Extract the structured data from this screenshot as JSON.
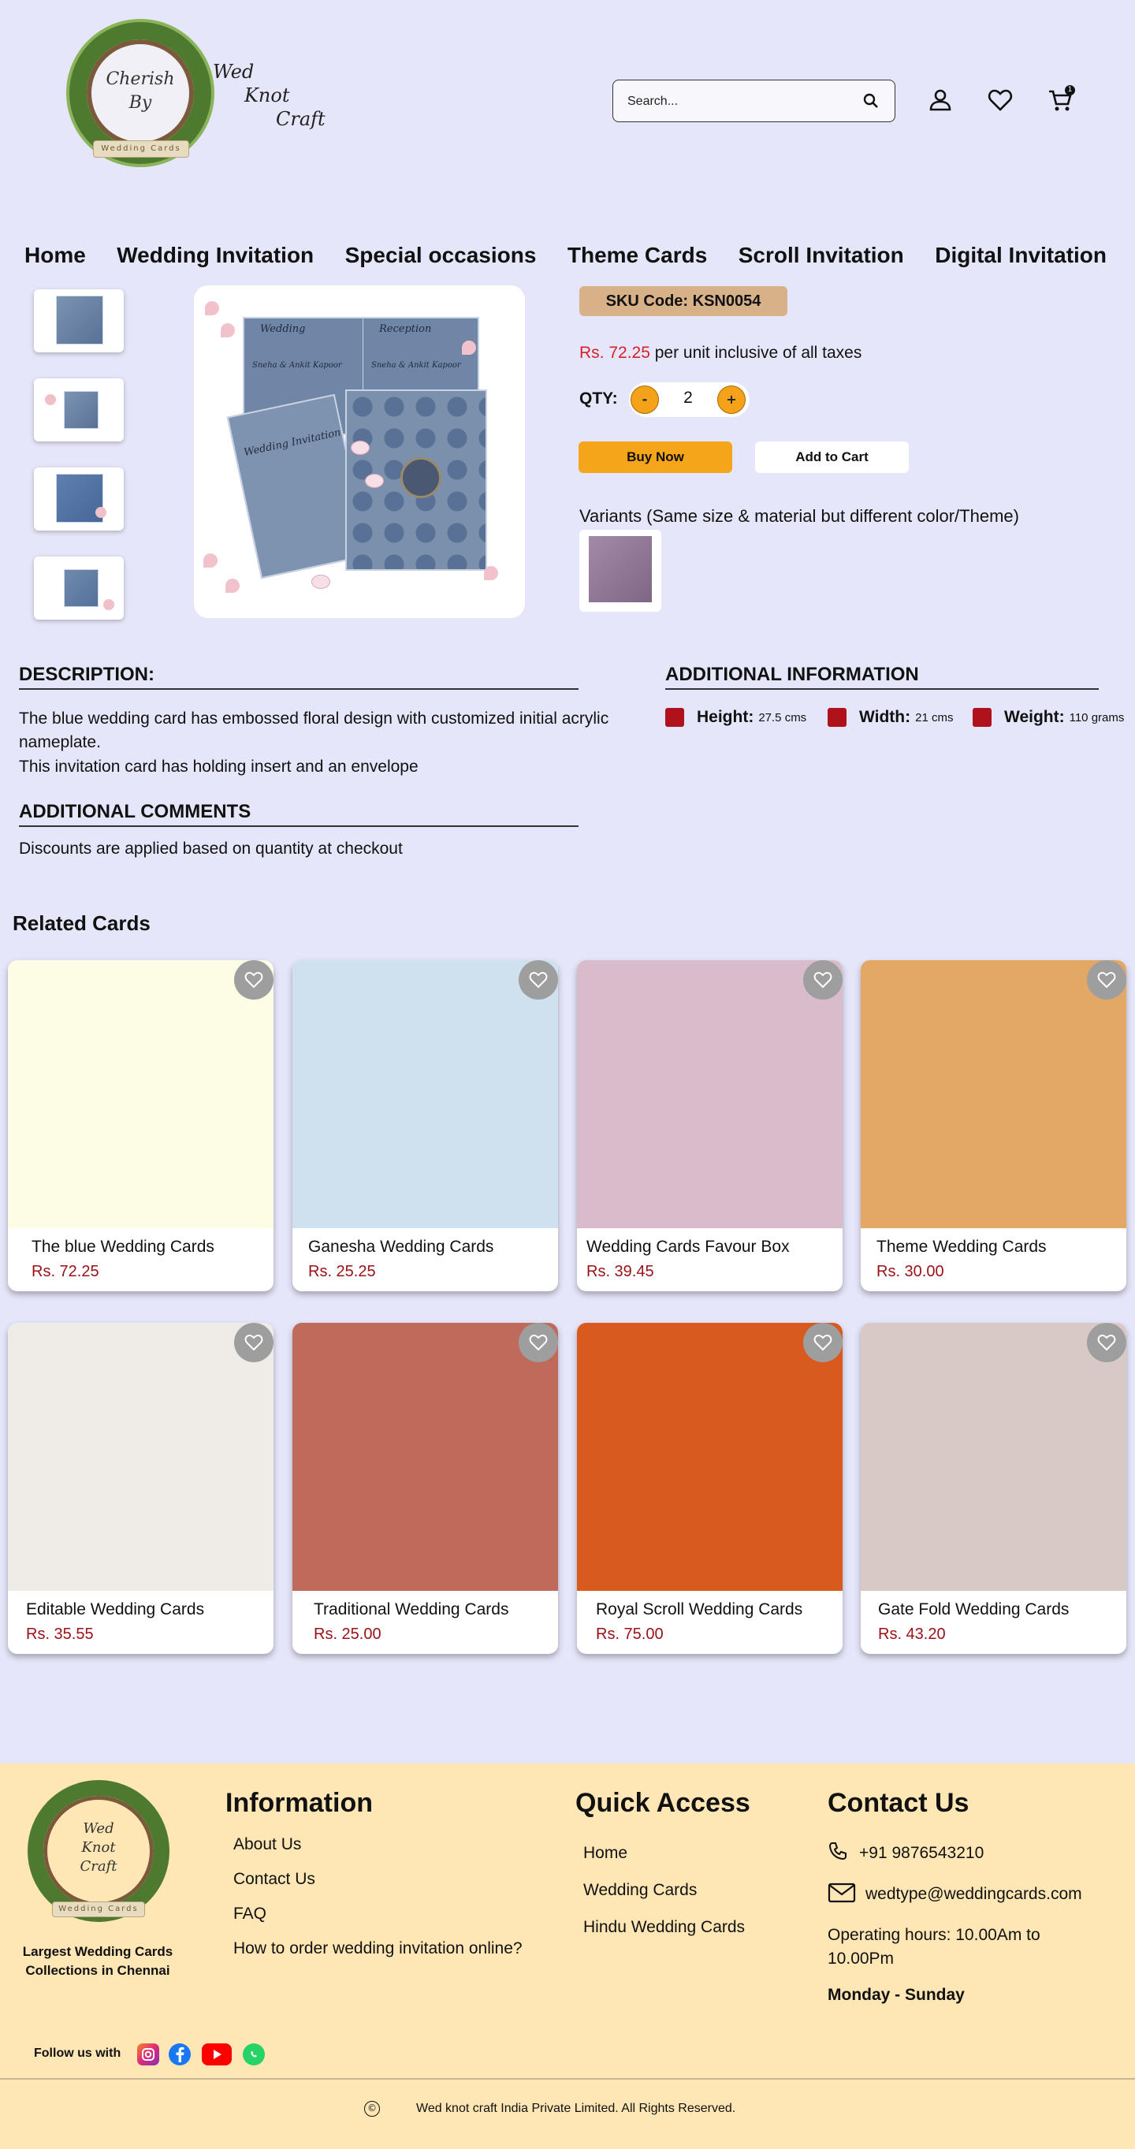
{
  "brand": {
    "wreath_text": [
      "Cherish",
      "By"
    ],
    "ribbon_text": "Wedding Cards",
    "script_lines": [
      "Wed",
      "Knot",
      "Craft"
    ],
    "footer_script_lines": [
      "Wed",
      "Knot",
      "Craft"
    ],
    "tagline": "Largest Wedding Cards Collections in Chennai"
  },
  "header": {
    "search_placeholder": "Search...",
    "cart_count": "1"
  },
  "nav": [
    "Home",
    "Wedding Invitation",
    "Special occasions",
    "Theme Cards",
    "Scroll Invitation",
    "Digital Invitation"
  ],
  "product": {
    "sku": "SKU Code: KSN0054",
    "price": "Rs. 72.25",
    "price_suffix": " per unit inclusive of all taxes",
    "qty_label": "QTY:",
    "qty_minus": "-",
    "qty_plus": "+",
    "qty_value": "2",
    "buy_now": "Buy Now",
    "add_to_cart": "Add to Cart",
    "variants_title": "Variants (Same size & material but different color/Theme)",
    "card_script": [
      "Wedding",
      "Reception",
      "Sneha & Ankit Kapoor",
      "Wedding Invitation",
      "Sneha & Ankit Kapoor"
    ]
  },
  "description": {
    "heading": "DESCRIPTION:",
    "line1": "The blue wedding card has embossed floral design with customized initial acrylic nameplate.",
    "line2": "This invitation card has holding insert and an envelope"
  },
  "additional_info": {
    "heading": "ADDITIONAL INFORMATION",
    "height_label": "Height:",
    "height_value": "27.5 cms",
    "width_label": "Width:",
    "width_value": "21 cms",
    "weight_label": "Weight:",
    "weight_value": "110 grams"
  },
  "comments": {
    "heading": "ADDITIONAL COMMENTS",
    "text": "Discounts are applied based on quantity at checkout"
  },
  "related": {
    "heading": "Related Cards",
    "cards": [
      {
        "name": "The blue Wedding Cards",
        "price": "Rs. 72.25",
        "bg": "#fdfde6"
      },
      {
        "name": "Ganesha Wedding Cards",
        "price": "Rs. 25.25",
        "bg": "#cfe0ef"
      },
      {
        "name": "Wedding Cards Favour Box",
        "price": "Rs. 39.45",
        "bg": "#d9bccb"
      },
      {
        "name": "Theme Wedding Cards",
        "price": "Rs. 30.00",
        "bg": "#e3a866"
      },
      {
        "name": "Editable Wedding Cards",
        "price": "Rs. 35.55",
        "bg": "#efece8"
      },
      {
        "name": "Traditional Wedding Cards",
        "price": "Rs. 25.00",
        "bg": "#c06a5c"
      },
      {
        "name": "Royal Scroll Wedding Cards",
        "price": "Rs. 75.00",
        "bg": "#d85a1e"
      },
      {
        "name": "Gate Fold Wedding Cards",
        "price": "Rs. 43.20",
        "bg": "#d8c8c6"
      }
    ]
  },
  "footer": {
    "information_title": "Information",
    "information_links": [
      "About Us",
      "Contact Us",
      "FAQ",
      "How to order wedding invitation online?"
    ],
    "quick_title": "Quick Access",
    "quick_links": [
      "Home",
      "Wedding Cards",
      "Hindu Wedding Cards"
    ],
    "contact_title": "Contact Us",
    "phone": "+91 9876543210",
    "email": "wedtype@weddingcards.com",
    "hours": "Operating hours: 10.00Am to 10.00Pm",
    "days": "Monday  - Sunday",
    "follow": "Follow us with",
    "copyright_symbol": "©",
    "copyright": "Wed knot craft India Private Limited. All Rights Reserved."
  },
  "colors": {
    "page_bg": "#e6e6fa",
    "accent": "#f5a519",
    "price_red": "#d6202a",
    "footer_bg": "#ffe6b5"
  },
  "icons": [
    "search-icon",
    "user-icon",
    "heart-icon",
    "cart-icon",
    "height-icon",
    "width-icon",
    "weight-icon",
    "phone-icon",
    "mail-icon",
    "instagram-icon",
    "facebook-icon",
    "youtube-icon",
    "whatsapp-icon"
  ]
}
